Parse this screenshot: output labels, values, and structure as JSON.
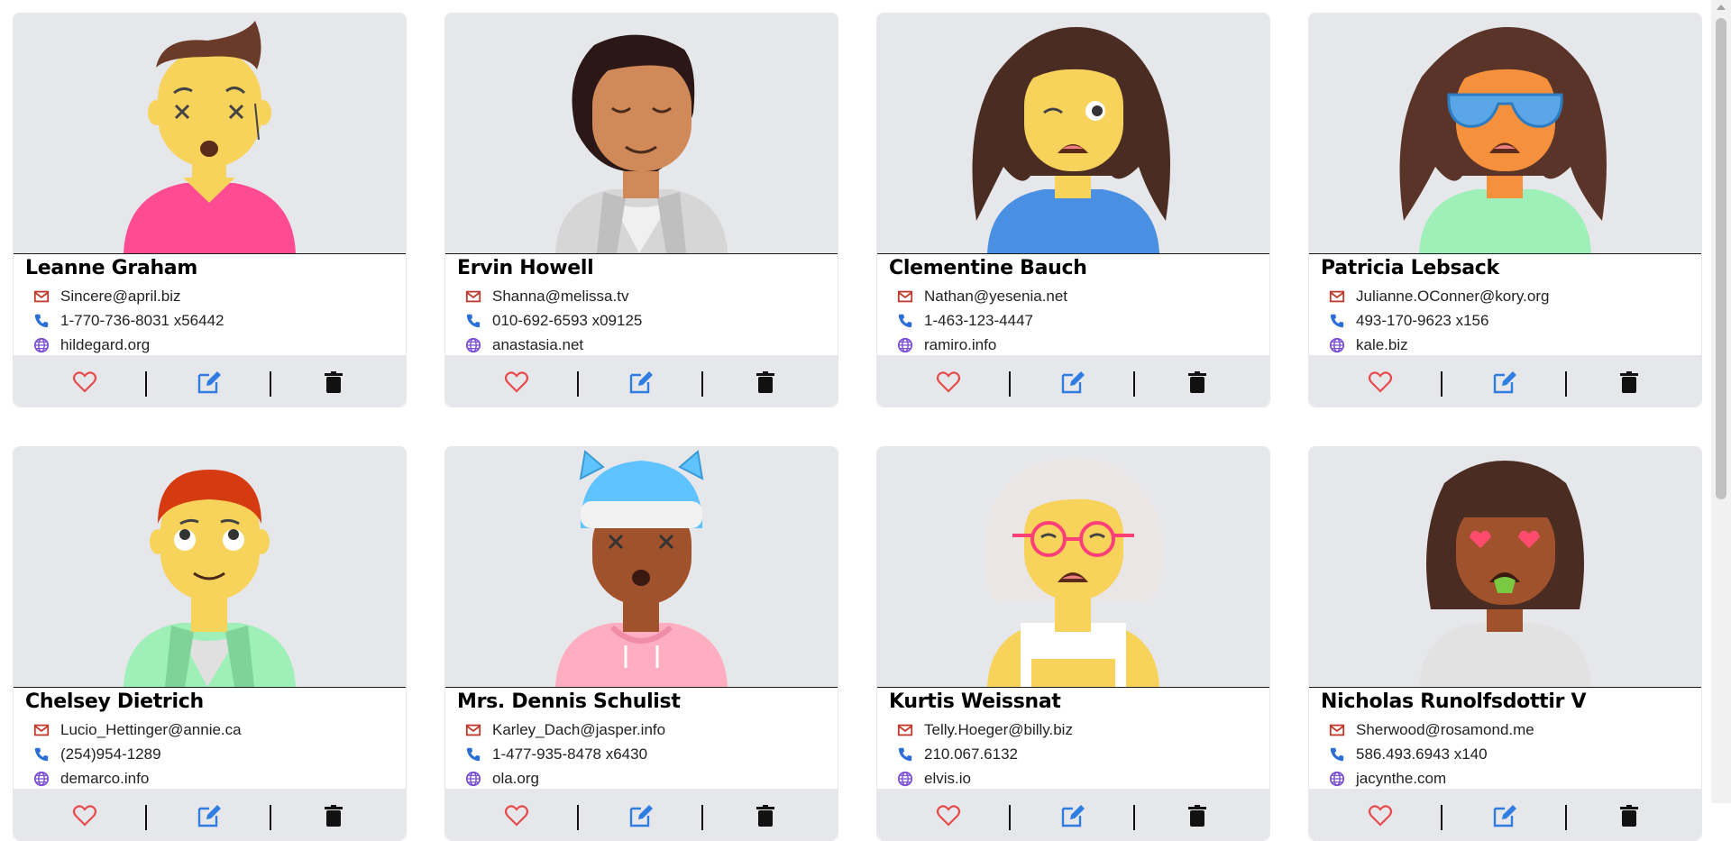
{
  "users": [
    {
      "name": "Leanne Graham",
      "email": "Sincere@april.biz",
      "phone": "1-770-736-8031 x56442",
      "website": "hildegard.org"
    },
    {
      "name": "Ervin Howell",
      "email": "Shanna@melissa.tv",
      "phone": "010-692-6593 x09125",
      "website": "anastasia.net"
    },
    {
      "name": "Clementine Bauch",
      "email": "Nathan@yesenia.net",
      "phone": "1-463-123-4447",
      "website": "ramiro.info"
    },
    {
      "name": "Patricia Lebsack",
      "email": "Julianne.OConner@kory.org",
      "phone": "493-170-9623 x156",
      "website": "kale.biz"
    },
    {
      "name": "Chelsey Dietrich",
      "email": "Lucio_Hettinger@annie.ca",
      "phone": "(254)954-1289",
      "website": "demarco.info"
    },
    {
      "name": "Mrs. Dennis Schulist",
      "email": "Karley_Dach@jasper.info",
      "phone": "1-477-935-8478 x6430",
      "website": "ola.org"
    },
    {
      "name": "Kurtis Weissnat",
      "email": "Telly.Hoeger@billy.biz",
      "phone": "210.067.6132",
      "website": "elvis.io"
    },
    {
      "name": "Nicholas Runolfsdottir V",
      "email": "Sherwood@rosamond.me",
      "phone": "586.493.6943 x140",
      "website": "jacynthe.com"
    }
  ],
  "icons": {
    "email": "envelope-icon",
    "phone": "phone-icon",
    "website": "globe-icon",
    "like": "heart-icon",
    "edit": "edit-icon",
    "delete": "trash-icon"
  },
  "colors": {
    "card_bg": "#e6e7eb",
    "email_icon": "#c0392b",
    "phone_icon": "#2b6fd6",
    "website_icon": "#7b4fd6",
    "heart_icon": "#e74c4c",
    "edit_icon": "#2f7de1",
    "trash_icon": "#111111"
  }
}
